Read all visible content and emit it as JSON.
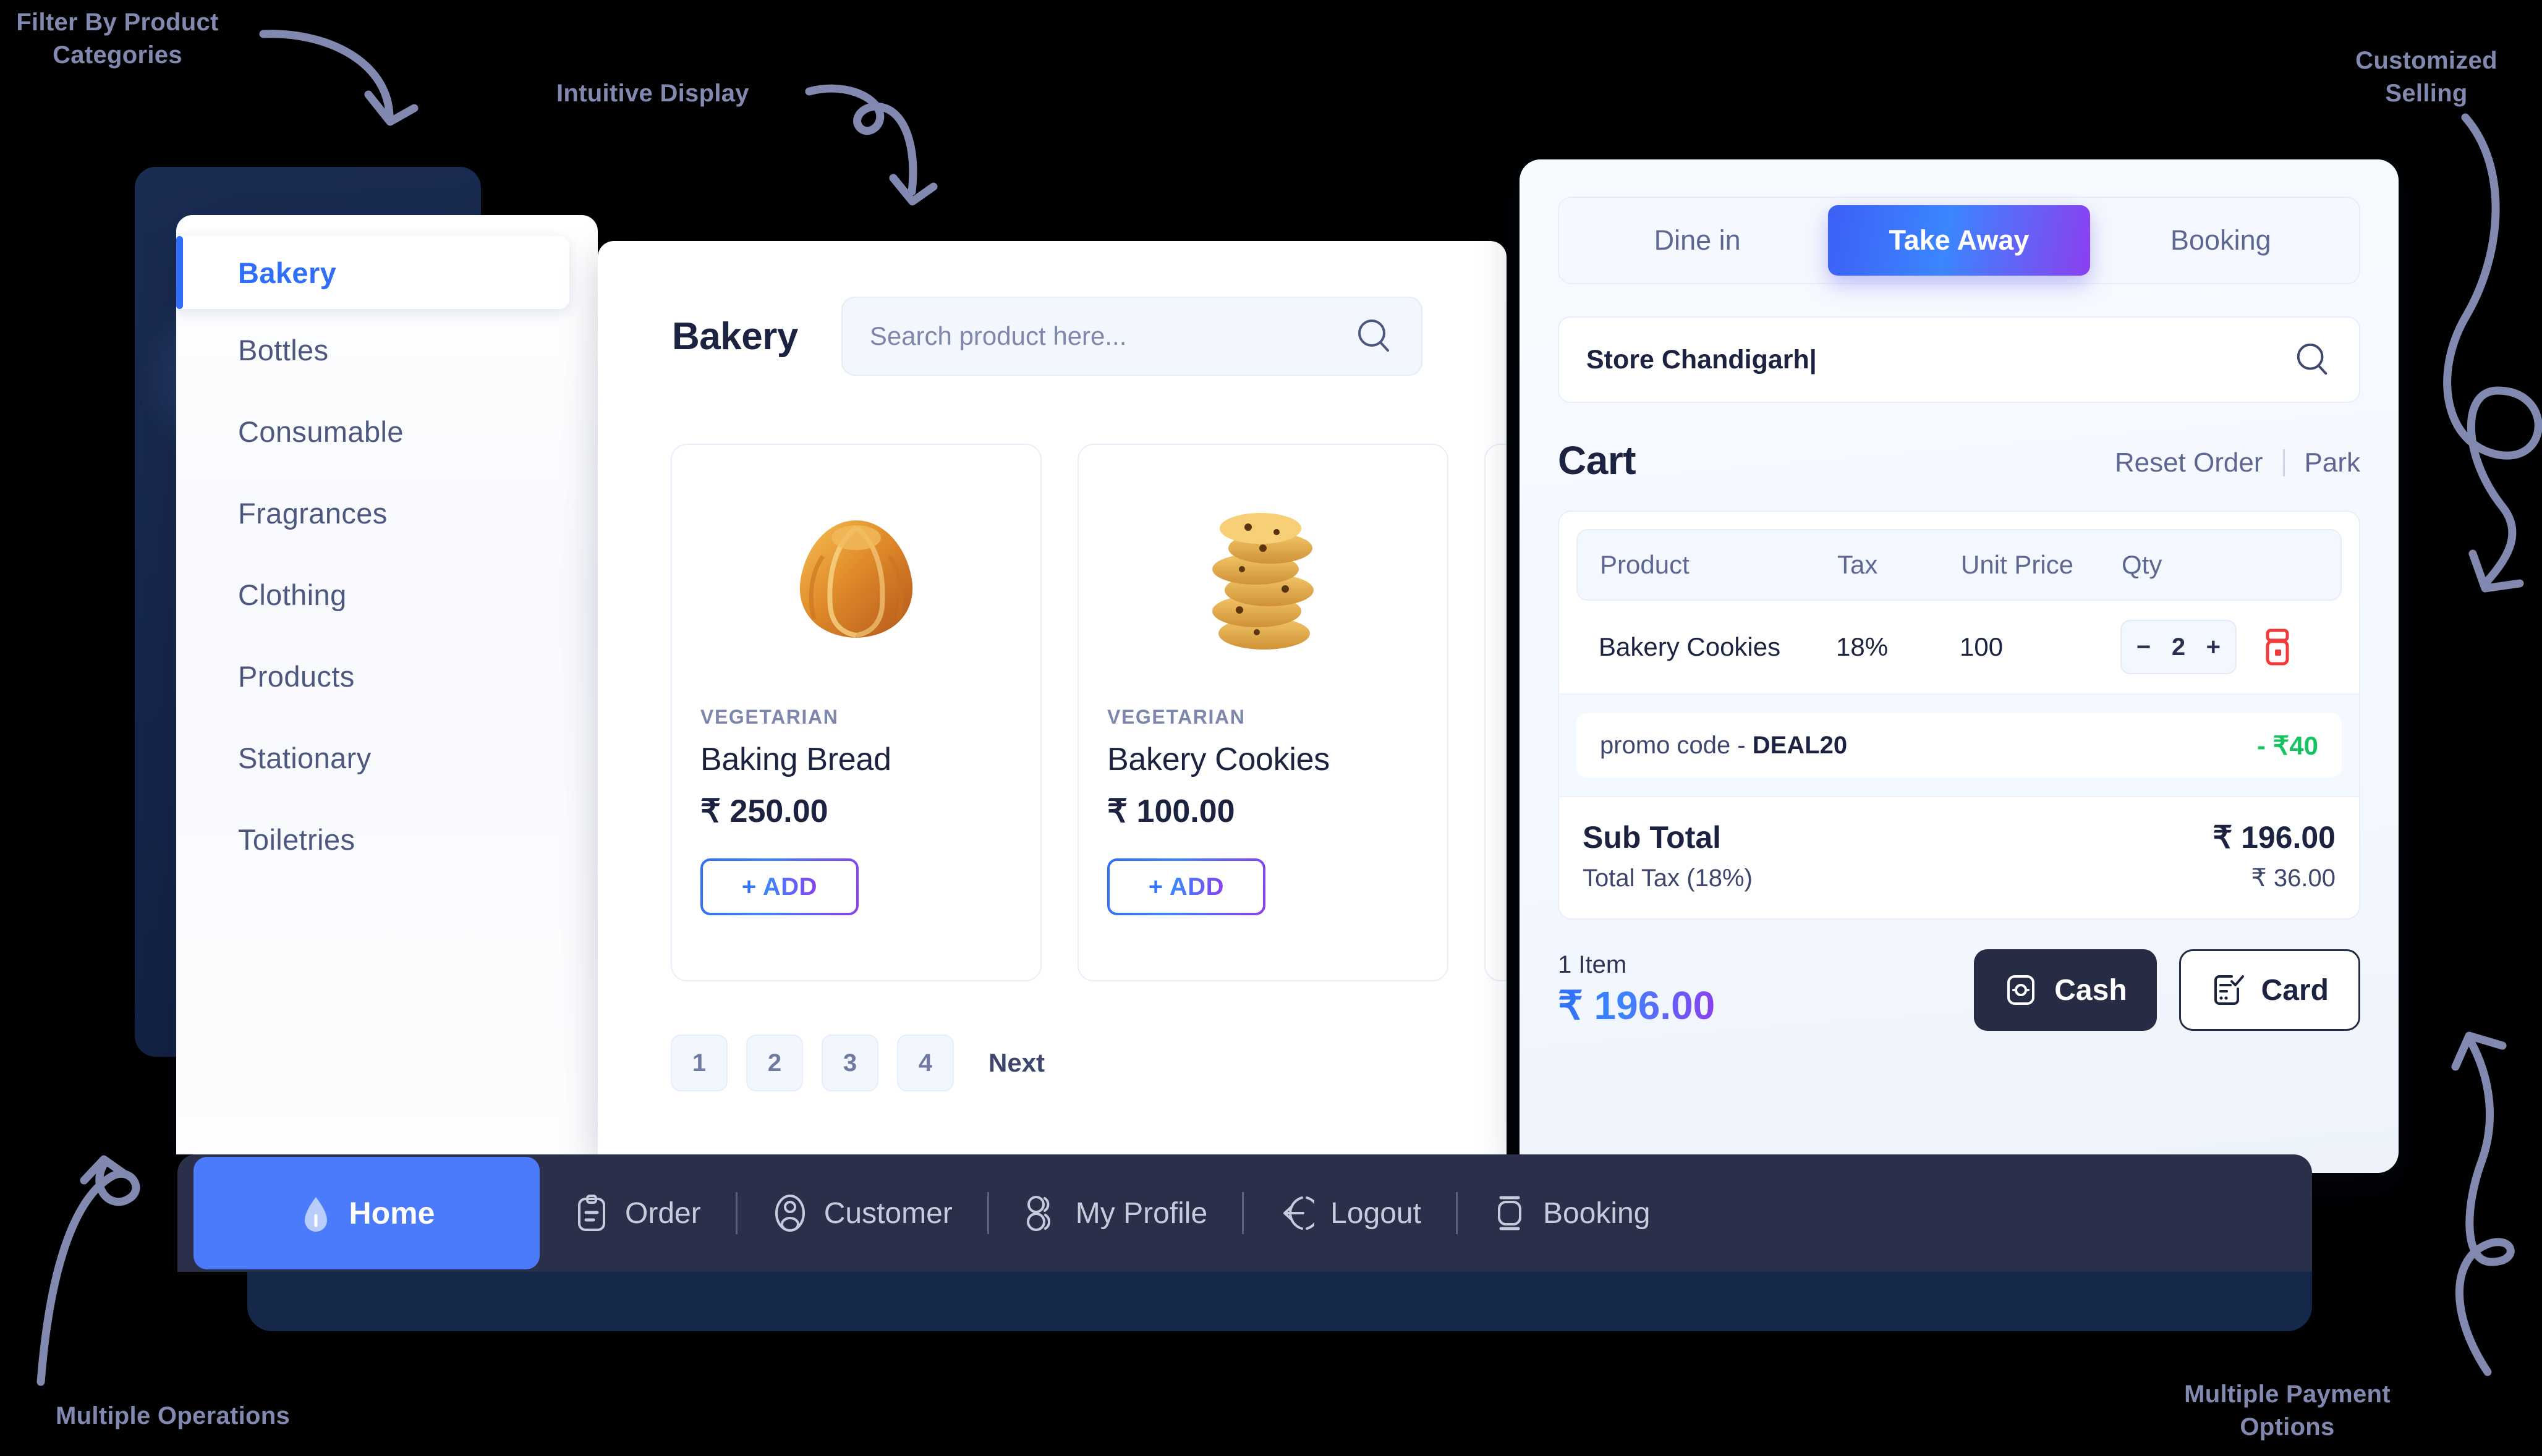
{
  "annotations": {
    "filter_categories": "Filter By Product\nCategories",
    "intuitive_display": "Intuitive Display",
    "customized_selling": "Customized\nSelling",
    "multiple_operations": "Multiple Operations",
    "multiple_payment": "Multiple Payment\nOptions"
  },
  "sidebar": {
    "items": [
      {
        "label": "Bakery",
        "active": true
      },
      {
        "label": "Bottles",
        "active": false
      },
      {
        "label": "Consumable",
        "active": false
      },
      {
        "label": "Fragrances",
        "active": false
      },
      {
        "label": "Clothing",
        "active": false
      },
      {
        "label": "Products",
        "active": false
      },
      {
        "label": "Stationary",
        "active": false
      },
      {
        "label": "Toiletries",
        "active": false
      }
    ]
  },
  "products_panel": {
    "title": "Bakery",
    "search_placeholder": "Search product here...",
    "search_value": "",
    "cards": [
      {
        "tag": "VEGETARIAN",
        "name": "Baking Bread",
        "price": "₹ 250.00",
        "add_label": "+ ADD",
        "image": "croissant"
      },
      {
        "tag": "VEGETARIAN",
        "name": "Bakery Cookies",
        "price": "₹ 100.00",
        "add_label": "+ ADD",
        "image": "cookies"
      }
    ],
    "pagination": {
      "pages": [
        "1",
        "2",
        "3",
        "4"
      ],
      "next_label": "Next",
      "current": "1"
    }
  },
  "cart_panel": {
    "tabs": [
      {
        "label": "Dine in",
        "active": false
      },
      {
        "label": "Take Away",
        "active": true
      },
      {
        "label": "Booking",
        "active": false
      }
    ],
    "store_value": "Store Chandigarh|",
    "store_placeholder": "Store",
    "title": "Cart",
    "reset_label": "Reset Order",
    "park_label": "Park",
    "columns": [
      "Product",
      "Tax",
      "Unit Price",
      "Qty"
    ],
    "rows": [
      {
        "product": "Bakery Cookies",
        "tax": "18%",
        "unit_price": "100",
        "qty": "2",
        "minus": "−",
        "plus": "+"
      }
    ],
    "promo": {
      "label": "promo code -",
      "code": "DEAL20",
      "discount": "- ₹40"
    },
    "totals": {
      "sub_total_label": "Sub Total",
      "sub_total_value": "₹ 196.00",
      "tax_label": "Total Tax (18%)",
      "tax_value": "₹ 36.00"
    },
    "footer": {
      "items_label": "1 Item",
      "total": "₹ 196.00",
      "cash_label": "Cash",
      "card_label": "Card"
    }
  },
  "bottom_nav": {
    "items": [
      {
        "label": "Home",
        "icon": "home-icon",
        "active": true
      },
      {
        "label": "Order",
        "icon": "clipboard-icon",
        "active": false
      },
      {
        "label": "Customer",
        "icon": "user-circle-icon",
        "active": false
      },
      {
        "label": "My Profile",
        "icon": "users-icon",
        "active": false
      },
      {
        "label": "Logout",
        "icon": "logout-icon",
        "active": false
      },
      {
        "label": "Booking",
        "icon": "booking-icon",
        "active": false
      }
    ]
  },
  "colors": {
    "accent_blue": "#2f6dfb",
    "accent_purple": "#8b3ff0",
    "nav_bg": "#2a3049",
    "navy_card": "#15254a",
    "discount_green": "#17c462",
    "delete_red": "#f23b3b",
    "annotation": "#8189b0"
  }
}
